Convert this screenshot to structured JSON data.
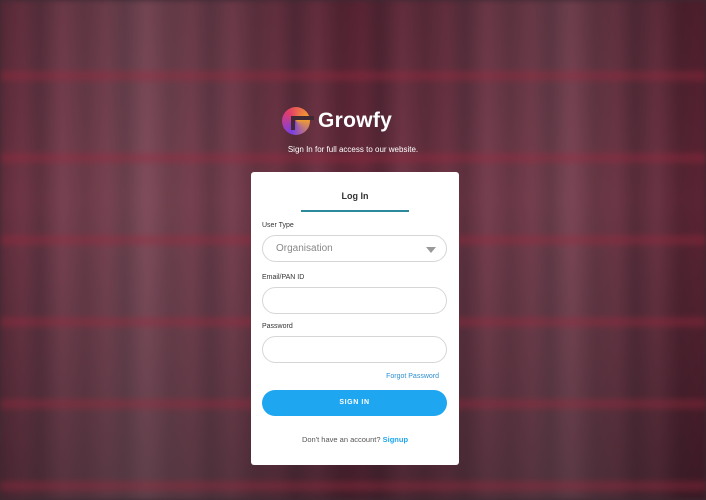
{
  "brand": {
    "name": "Growfy",
    "tagline": "Sign In for full access to our website."
  },
  "login_card": {
    "tab_label": "Log In",
    "user_type": {
      "label": "User Type",
      "selected": "Organisation"
    },
    "email": {
      "label": "Email/PAN ID",
      "value": ""
    },
    "password": {
      "label": "Password",
      "value": ""
    },
    "forgot_password": "Forgot Password",
    "sign_in_button": "SIGN IN",
    "footer_text": "Don't have an account?",
    "signup_link": "Signup"
  },
  "colors": {
    "accent": "#1fa6f0",
    "tab_underline": "#2c8a9a"
  },
  "icons": {
    "logo": "growfy-logo-icon",
    "select_caret": "chevron-down-icon"
  }
}
